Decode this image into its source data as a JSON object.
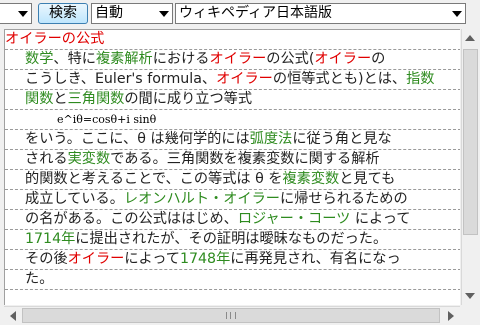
{
  "toolbar": {
    "query_value": "",
    "search_label": "検索",
    "mode_value": "自動",
    "dictionary_value": "ウィキペディア日本語版"
  },
  "article": {
    "title": "オイラーの公式",
    "lines": [
      [
        {
          "t": "数学",
          "c": "green"
        },
        {
          "t": "、特に",
          "c": "plain"
        },
        {
          "t": "複素解析",
          "c": "green"
        },
        {
          "t": "における",
          "c": "plain"
        },
        {
          "t": "オイラー",
          "c": "red"
        },
        {
          "t": "の公式(",
          "c": "plain"
        },
        {
          "t": "オイラー",
          "c": "red"
        },
        {
          "t": "の",
          "c": "plain"
        }
      ],
      [
        {
          "t": "こうしき、Euler's formula、",
          "c": "plain"
        },
        {
          "t": "オイラー",
          "c": "red"
        },
        {
          "t": "の恒等式とも)とは、",
          "c": "plain"
        },
        {
          "t": "指数",
          "c": "green"
        }
      ],
      [
        {
          "t": "関数",
          "c": "green"
        },
        {
          "t": "と",
          "c": "plain"
        },
        {
          "t": "三角関数",
          "c": "green"
        },
        {
          "t": "の間に成り立つ等式",
          "c": "plain"
        }
      ],
      [
        {
          "t": "e^iθ=cosθ+i sinθ",
          "c": "formula"
        }
      ],
      [
        {
          "t": "をいう。ここに、θ は幾何学的には",
          "c": "plain"
        },
        {
          "t": "弧度法",
          "c": "green"
        },
        {
          "t": "に従う角と見な",
          "c": "plain"
        }
      ],
      [
        {
          "t": "される",
          "c": "plain"
        },
        {
          "t": "実変数",
          "c": "green"
        },
        {
          "t": "である。三角関数を複素変数に関する解析",
          "c": "plain"
        }
      ],
      [
        {
          "t": "的関数と考えることで、この等式は θ を",
          "c": "plain"
        },
        {
          "t": "複素変数",
          "c": "green"
        },
        {
          "t": "と見ても",
          "c": "plain"
        }
      ],
      [
        {
          "t": "成立している。",
          "c": "plain"
        },
        {
          "t": "レオンハルト・オイラー",
          "c": "green"
        },
        {
          "t": "に帰せられるための",
          "c": "plain"
        }
      ],
      [
        {
          "t": "の名がある。この公式ははじめ、",
          "c": "plain"
        },
        {
          "t": "ロジャー・コーツ",
          "c": "green"
        },
        {
          "t": " によって",
          "c": "plain"
        }
      ],
      [
        {
          "t": "1714年",
          "c": "green"
        },
        {
          "t": "に提出されたが、その証明は曖昧なものだった。",
          "c": "plain"
        }
      ],
      [
        {
          "t": "その後",
          "c": "plain"
        },
        {
          "t": "オイラー",
          "c": "red"
        },
        {
          "t": "によって",
          "c": "plain"
        },
        {
          "t": "1748年",
          "c": "green"
        },
        {
          "t": "に再発見され、有名になっ",
          "c": "plain"
        }
      ],
      [
        {
          "t": "た。",
          "c": "plain"
        }
      ]
    ]
  },
  "colors": {
    "link_red": "#e00000",
    "link_green": "#2e8b1f",
    "text": "#222222"
  },
  "icons": {
    "query_dropdown": "chevron-down-icon",
    "mode_dropdown": "chevron-down-icon",
    "dictionary_dropdown": "chevron-down-icon"
  }
}
